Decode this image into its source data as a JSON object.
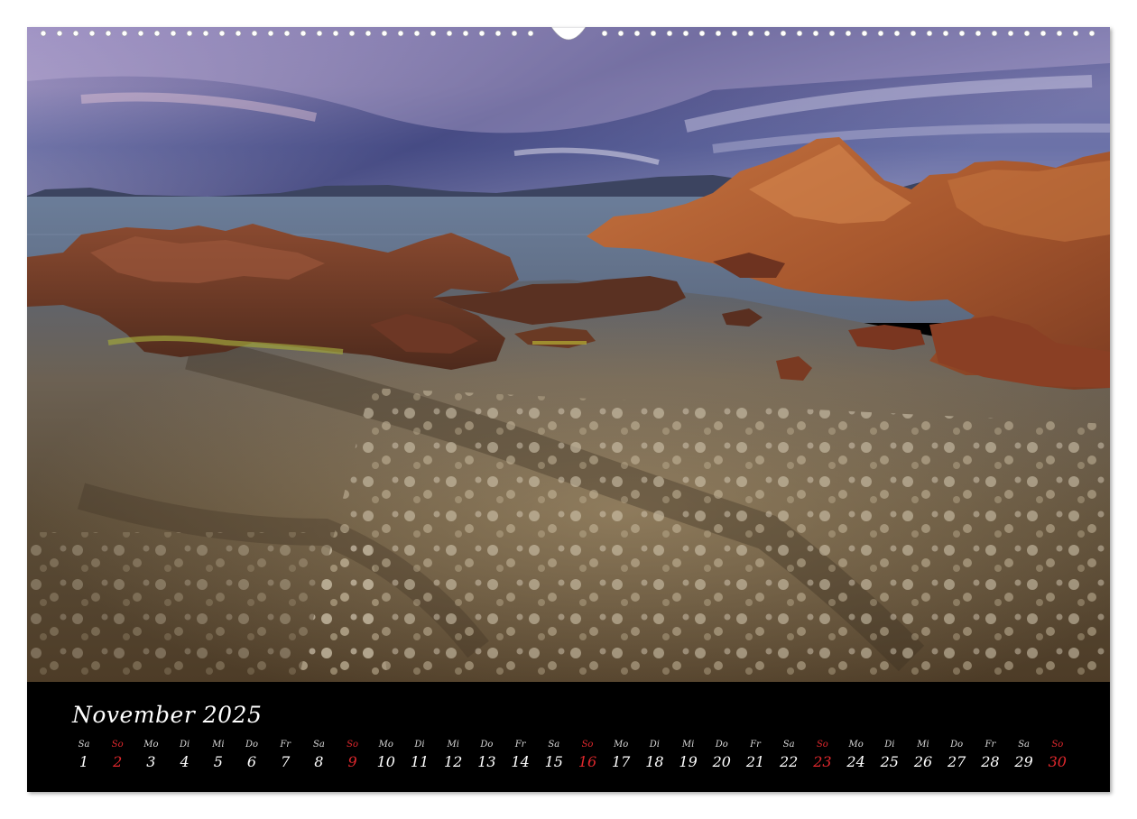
{
  "calendar": {
    "title": "November 2025",
    "days": [
      {
        "abbr": "Sa",
        "num": "1",
        "sunday": false
      },
      {
        "abbr": "So",
        "num": "2",
        "sunday": true
      },
      {
        "abbr": "Mo",
        "num": "3",
        "sunday": false
      },
      {
        "abbr": "Di",
        "num": "4",
        "sunday": false
      },
      {
        "abbr": "Mi",
        "num": "5",
        "sunday": false
      },
      {
        "abbr": "Do",
        "num": "6",
        "sunday": false
      },
      {
        "abbr": "Fr",
        "num": "7",
        "sunday": false
      },
      {
        "abbr": "Sa",
        "num": "8",
        "sunday": false
      },
      {
        "abbr": "So",
        "num": "9",
        "sunday": true
      },
      {
        "abbr": "Mo",
        "num": "10",
        "sunday": false
      },
      {
        "abbr": "Di",
        "num": "11",
        "sunday": false
      },
      {
        "abbr": "Mi",
        "num": "12",
        "sunday": false
      },
      {
        "abbr": "Do",
        "num": "13",
        "sunday": false
      },
      {
        "abbr": "Fr",
        "num": "14",
        "sunday": false
      },
      {
        "abbr": "Sa",
        "num": "15",
        "sunday": false
      },
      {
        "abbr": "So",
        "num": "16",
        "sunday": true
      },
      {
        "abbr": "Mo",
        "num": "17",
        "sunday": false
      },
      {
        "abbr": "Di",
        "num": "18",
        "sunday": false
      },
      {
        "abbr": "Mi",
        "num": "19",
        "sunday": false
      },
      {
        "abbr": "Do",
        "num": "20",
        "sunday": false
      },
      {
        "abbr": "Fr",
        "num": "21",
        "sunday": false
      },
      {
        "abbr": "Sa",
        "num": "22",
        "sunday": false
      },
      {
        "abbr": "So",
        "num": "23",
        "sunday": true
      },
      {
        "abbr": "Mo",
        "num": "24",
        "sunday": false
      },
      {
        "abbr": "Di",
        "num": "25",
        "sunday": false
      },
      {
        "abbr": "Mi",
        "num": "26",
        "sunday": false
      },
      {
        "abbr": "Do",
        "num": "27",
        "sunday": false
      },
      {
        "abbr": "Fr",
        "num": "28",
        "sunday": false
      },
      {
        "abbr": "Sa",
        "num": "29",
        "sunday": false
      },
      {
        "abbr": "So",
        "num": "30",
        "sunday": true
      }
    ]
  },
  "colors": {
    "sunday": "#e0282d",
    "weekday": "#ffffff",
    "footer_background": "#000000"
  }
}
